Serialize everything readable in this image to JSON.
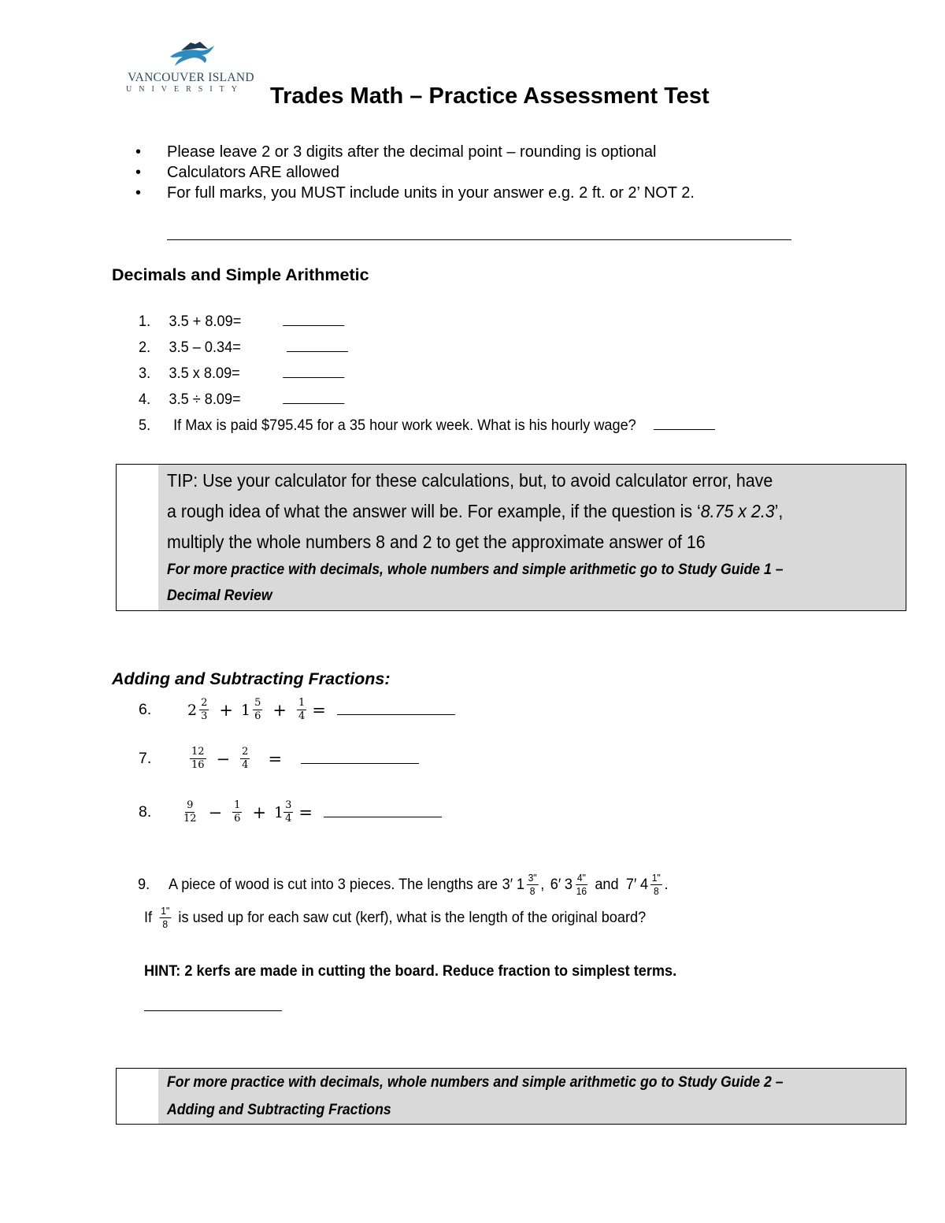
{
  "header": {
    "logo": {
      "line1": "VANCOUVER ISLAND",
      "line2": "UNIVERSITY",
      "colors": {
        "dark": "#1f3a4d",
        "blue": "#2e8bc0",
        "text": "#2f4a5a"
      }
    },
    "title": "Trades Math – Practice Assessment Test"
  },
  "instructions": [
    "Please leave 2 or 3 digits after the decimal point – rounding is optional",
    "Calculators ARE allowed",
    "For full marks, you MUST include units in your answer e.g. 2 ft. or 2’ NOT 2."
  ],
  "sections": {
    "decimals": {
      "heading": "Decimals and Simple Arithmetic",
      "questions": [
        {
          "num": "1.",
          "text": "3.5 + 8.09="
        },
        {
          "num": "2.",
          "text": "3.5 – 0.34="
        },
        {
          "num": "3.",
          "text": "3.5 x 8.09="
        },
        {
          "num": "4.",
          "text": "3.5 ÷ 8.09="
        },
        {
          "num": "5.",
          "text": "If Max is paid $795.45 for a 35 hour work week. What is his hourly wage?"
        }
      ],
      "tip_box": {
        "lines": [
          "TIP: Use your calculator for these calculations, but, to avoid calculator error, have",
          "a rough idea of what the answer will be. For example, if the question is ‘",
          "8.75 x 2.3",
          "’,",
          "multiply the whole numbers 8 and 2 to get the approximate answer of 16"
        ],
        "more_practice": [
          "For more practice with decimals, whole numbers and simple arithmetic go to Study Guide 1 –",
          "Decimal Review"
        ],
        "shade_color": "#d9d9d9"
      }
    },
    "fractions": {
      "heading": "Adding and Subtracting Fractions:",
      "q6": {
        "num": "6.",
        "terms": [
          {
            "whole": "2",
            "n": "2",
            "d": "3"
          },
          {
            "op": "+"
          },
          {
            "whole": "1",
            "n": "5",
            "d": "6"
          },
          {
            "op": "+"
          },
          {
            "n": "1",
            "d": "4"
          },
          {
            "op": "="
          }
        ]
      },
      "q7": {
        "num": "7.",
        "terms": [
          {
            "n": "12",
            "d": "16"
          },
          {
            "op": "−"
          },
          {
            "n": "2",
            "d": "4"
          },
          {
            "op": "="
          }
        ]
      },
      "q8": {
        "num": "8.",
        "terms": [
          {
            "n": "9",
            "d": "12"
          },
          {
            "op": "−"
          },
          {
            "n": "1",
            "d": "6"
          },
          {
            "op": "+"
          },
          {
            "whole": "1",
            "n": "3",
            "d": "4"
          },
          {
            "op": "="
          }
        ]
      },
      "q9": {
        "num": "9.",
        "text_a": "A piece of wood is cut into 3 pieces.  The lengths are",
        "len1": {
          "feet": "3′",
          "whole": "1",
          "n": "3\"",
          "d": "8"
        },
        "sep1": ",",
        "len2": {
          "feet": "6′",
          "whole": "3",
          "n": "4\"",
          "d": "16"
        },
        "and": "and",
        "len3": {
          "feet": "7′",
          "whole": "4",
          "n": "1\"",
          "d": "8"
        },
        "end": ".",
        "line2_if": "If",
        "kerf": {
          "n": "1\"",
          "d": "8"
        },
        "line2_rest": "is used up for each saw cut (kerf), what is the length of the original board?",
        "hint": "HINT: 2 kerfs are made in cutting the board.  Reduce fraction to simplest terms."
      },
      "guide_box": {
        "more_practice": [
          "For more practice with decimals, whole numbers and simple arithmetic go to Study Guide 2 –",
          "Adding and Subtracting Fractions"
        ]
      }
    }
  }
}
